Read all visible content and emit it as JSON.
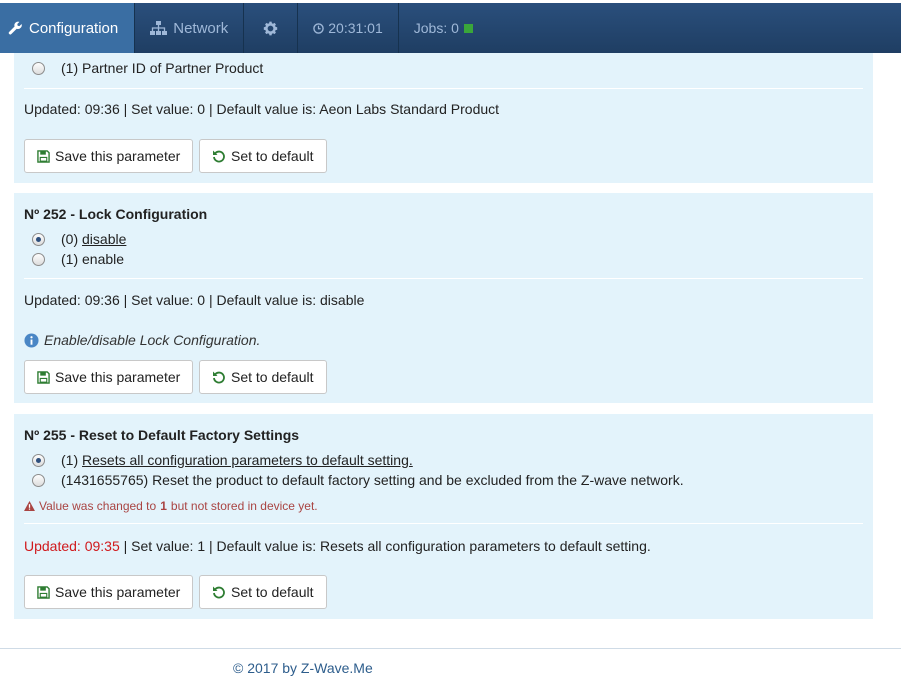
{
  "nav": {
    "configuration": "Configuration",
    "network": "Network",
    "time": "20:31:01",
    "jobs": "Jobs: 0"
  },
  "buttons": {
    "save": "Save this parameter",
    "default": "Set to default"
  },
  "panel1": {
    "option_partner": "(1) Partner ID of Partner Product",
    "updated": "Updated: 09:36 | Set value: 0 | Default value is: Aeon Labs Standard Product"
  },
  "panel2": {
    "title": "Nº 252 - Lock Configuration",
    "opt0_prefix": "(0)",
    "opt0_label": "disable",
    "opt1": "(1) enable",
    "updated": "Updated: 09:36 | Set value: 0 | Default value is: disable",
    "info": "Enable/disable Lock Configuration."
  },
  "panel3": {
    "title": "Nº 255 - Reset to Default Factory Settings",
    "opt0_prefix": "(1)",
    "opt0_label": "Resets all configuration parameters to default setting.",
    "opt1": "(1431655765) Reset the product to default factory setting and be excluded from the Z-wave network.",
    "warn_pre": "Value was changed to",
    "warn_value": "1",
    "warn_post": "but not stored in device yet.",
    "updated_time": "Updated: 09:35",
    "updated_rest": " | Set value: 1 | Default value is: Resets all configuration parameters to default setting."
  },
  "footer": "© 2017 by Z-Wave.Me",
  "colors": {
    "nav": "#1f3e63",
    "nav_active": "#3a6ea3",
    "panel": "#e3f3fb",
    "warning": "#a94442",
    "updated_red": "#d0191c"
  }
}
